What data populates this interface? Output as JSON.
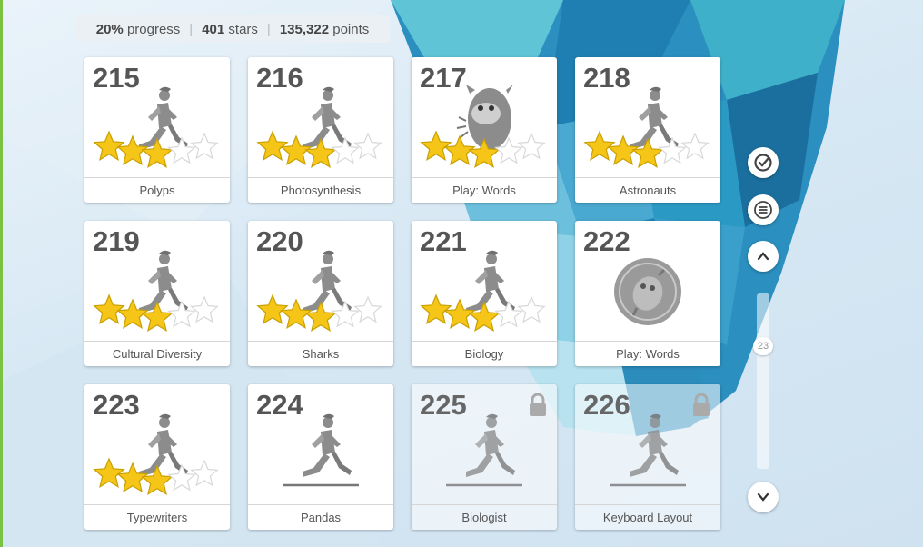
{
  "stats": {
    "progress_value": "20%",
    "progress_label": "progress",
    "stars_value": "401",
    "stars_label": "stars",
    "points_value": "135,322",
    "points_label": "points"
  },
  "lessons": [
    {
      "number": "215",
      "label": "Polyps",
      "type": "runner",
      "stars": 3,
      "locked": false
    },
    {
      "number": "216",
      "label": "Photosynthesis",
      "type": "runner",
      "stars": 3,
      "locked": false
    },
    {
      "number": "217",
      "label": "Play: Words",
      "type": "monster",
      "stars": 3,
      "locked": false
    },
    {
      "number": "218",
      "label": "Astronauts",
      "type": "runner",
      "stars": 3,
      "locked": false
    },
    {
      "number": "219",
      "label": "Cultural Diversity",
      "type": "runner",
      "stars": 3,
      "locked": false
    },
    {
      "number": "220",
      "label": "Sharks",
      "type": "runner",
      "stars": 3,
      "locked": false
    },
    {
      "number": "221",
      "label": "Biology",
      "type": "runner",
      "stars": 3,
      "locked": false
    },
    {
      "number": "222",
      "label": "Play: Words",
      "type": "game-badge",
      "stars": 0,
      "locked": false
    },
    {
      "number": "223",
      "label": "Typewriters",
      "type": "runner",
      "stars": 3,
      "locked": false
    },
    {
      "number": "224",
      "label": "Pandas",
      "type": "runner-track",
      "stars": 0,
      "locked": false
    },
    {
      "number": "225",
      "label": "Biologist",
      "type": "runner-track",
      "stars": 0,
      "locked": true
    },
    {
      "number": "226",
      "label": "Keyboard Layout",
      "type": "runner-track",
      "stars": 0,
      "locked": true
    }
  ],
  "side_controls": {
    "check_icon": "check-circle-icon",
    "menu_icon": "hamburger-menu-icon",
    "up_icon": "chevron-up-icon",
    "down_icon": "chevron-down-icon",
    "slider_value": "23"
  },
  "colors": {
    "star_filled": "#f5c518",
    "star_empty": "#ffffff",
    "accent_green": "#7cc242",
    "figure_gray": "#8c8c8c"
  }
}
